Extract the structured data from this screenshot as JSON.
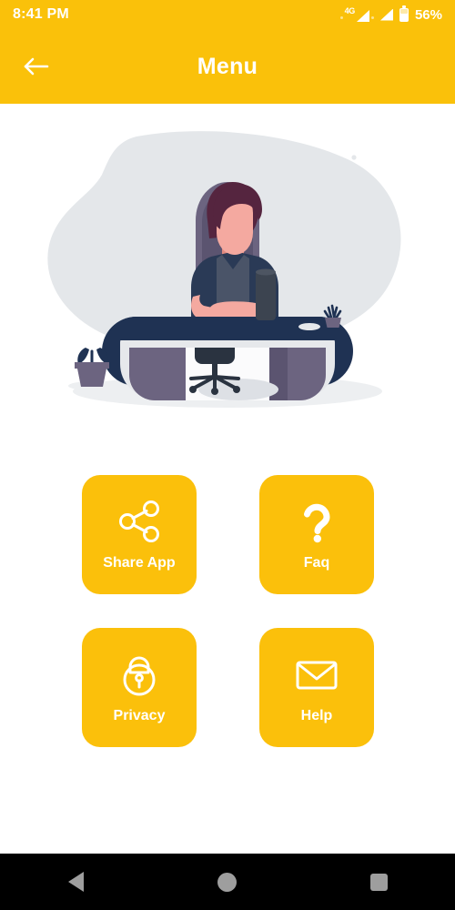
{
  "status_bar": {
    "time": "8:41 PM",
    "network_label": "4G",
    "battery_percent": "56%",
    "icons": [
      "signal-4g-icon",
      "signal-bars-icon",
      "battery-icon"
    ]
  },
  "app_bar": {
    "title": "Menu",
    "back_icon": "arrow-left-icon",
    "background_color": "#FAC10A",
    "text_color": "#FFFFFF"
  },
  "illustration": {
    "name": "person-at-desk-illustration",
    "colors": {
      "blob": "#E4E7EA",
      "desk_top": "#1F3253",
      "desk_edge": "#E6E8EB",
      "desk_side": "#6C6480",
      "skin": "#F4A9A0",
      "hair": "#55253F",
      "chair": "#6C6480",
      "shadow": "#D8DBE0"
    }
  },
  "menu": {
    "tile_color": "#FBC00B",
    "label_color": "#FFFFFF",
    "items": [
      {
        "label": "Share App",
        "icon": "share-icon"
      },
      {
        "label": "Faq",
        "icon": "question-mark-icon"
      },
      {
        "label": "Privacy",
        "icon": "lock-icon"
      },
      {
        "label": "Help",
        "icon": "envelope-icon"
      }
    ]
  },
  "nav_bar": {
    "background_color": "#000000",
    "buttons": [
      {
        "name": "back",
        "icon": "triangle-back-icon"
      },
      {
        "name": "home",
        "icon": "circle-home-icon"
      },
      {
        "name": "recents",
        "icon": "square-recents-icon"
      }
    ]
  }
}
